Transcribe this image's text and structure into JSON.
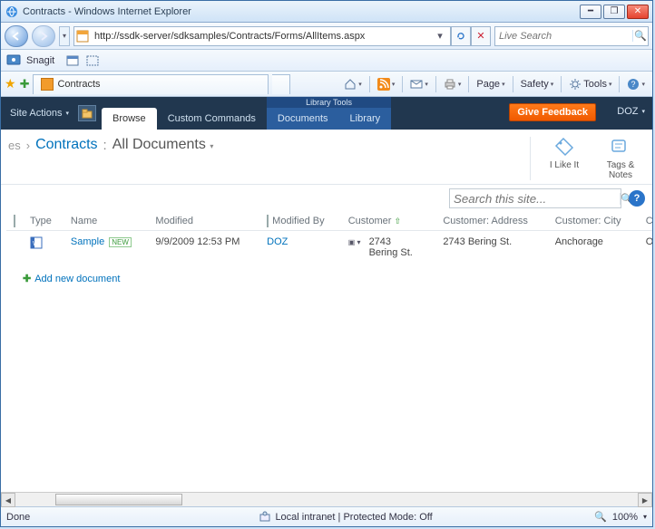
{
  "window": {
    "title": "Contracts - Windows Internet Explorer"
  },
  "nav": {
    "url": "http://ssdk-server/sdksamples/Contracts/Forms/AllItems.aspx",
    "search_placeholder": "Live Search"
  },
  "toolbar": {
    "snagit_label": "Snagit"
  },
  "tabs": {
    "active_label": "Contracts"
  },
  "commands": {
    "page": "Page",
    "safety": "Safety",
    "tools": "Tools"
  },
  "ribbon": {
    "site_actions": "Site Actions",
    "browse": "Browse",
    "custom": "Custom Commands",
    "group_title": "Library Tools",
    "documents": "Documents",
    "library": "Library",
    "feedback": "Give Feedback",
    "user": "DOZ"
  },
  "pagehead": {
    "crumb_prefix": "es",
    "library": "Contracts",
    "view": "All Documents",
    "like": "I Like It",
    "tags": "Tags & Notes"
  },
  "search": {
    "placeholder": "Search this site..."
  },
  "columns": {
    "type": "Type",
    "name": "Name",
    "modified": "Modified",
    "modified_by": "Modified By",
    "customer": "Customer",
    "customer_address": "Customer: Address",
    "customer_city": "Customer: City",
    "customer_extra": "Custom"
  },
  "rows": [
    {
      "name": "Sample",
      "is_new": true,
      "new_label": "NEW",
      "modified": "9/9/2009 12:53 PM",
      "modified_by": "DOZ",
      "customer": "2743 Bering St.",
      "customer_address": "2743 Bering St.",
      "customer_city": "Anchorage",
      "customer_extra": "Old Wor"
    }
  ],
  "addnew": "Add new document",
  "status": {
    "left": "Done",
    "mid": "Local intranet | Protected Mode: Off",
    "zoom": "100%"
  }
}
